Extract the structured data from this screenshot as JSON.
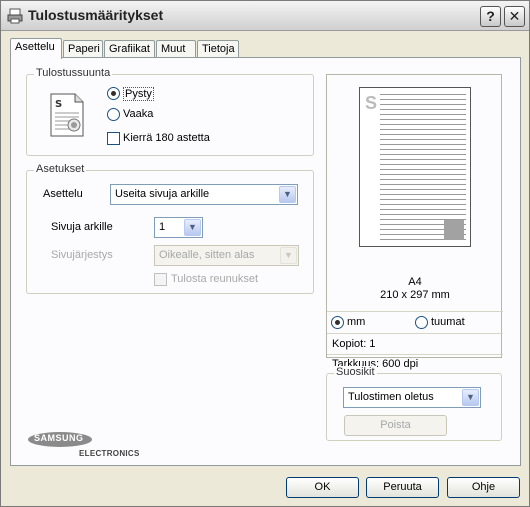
{
  "window": {
    "title": "Tulostusmääritykset",
    "help_button": "?",
    "close_button": "✕"
  },
  "tabs": [
    {
      "label": "Asettelu",
      "active": true
    },
    {
      "label": "Paperi",
      "active": false
    },
    {
      "label": "Grafiikat",
      "active": false
    },
    {
      "label": "Muut",
      "active": false
    },
    {
      "label": "Tietoja",
      "active": false
    }
  ],
  "orientation": {
    "title": "Tulostussuunta",
    "portrait_label": "Pysty",
    "portrait_selected": true,
    "landscape_label": "Vaaka",
    "landscape_selected": false,
    "rotate_label": "Kierrä 180 astetta",
    "rotate_checked": false
  },
  "settings": {
    "title": "Asetukset",
    "layout_label": "Asettelu",
    "layout_value": "Useita sivuja arkille",
    "pages_per_sheet_label": "Sivuja arkille",
    "pages_per_sheet_value": "1",
    "page_order_label": "Sivujärjestys",
    "page_order_value": "Oikealle, sitten alas",
    "print_borders_label": "Tulosta reunukset",
    "print_borders_checked": false
  },
  "preview": {
    "paper_name": "A4",
    "paper_size": "210 x 297 mm",
    "unit_mm_label": "mm",
    "unit_mm_selected": true,
    "unit_inch_label": "tuumat",
    "unit_inch_selected": false,
    "copies_text": "Kopiot: 1",
    "resolution_text": "Tarkkuus: 600 dpi"
  },
  "favorites": {
    "title": "Suosikit",
    "selected": "Tulostimen oletus",
    "delete_label": "Poista"
  },
  "branding": {
    "logo_text": "SAMSUNG",
    "logo_subtext": "ELECTRONICS"
  },
  "buttons": {
    "ok": "OK",
    "cancel": "Peruuta",
    "help": "Ohje"
  }
}
